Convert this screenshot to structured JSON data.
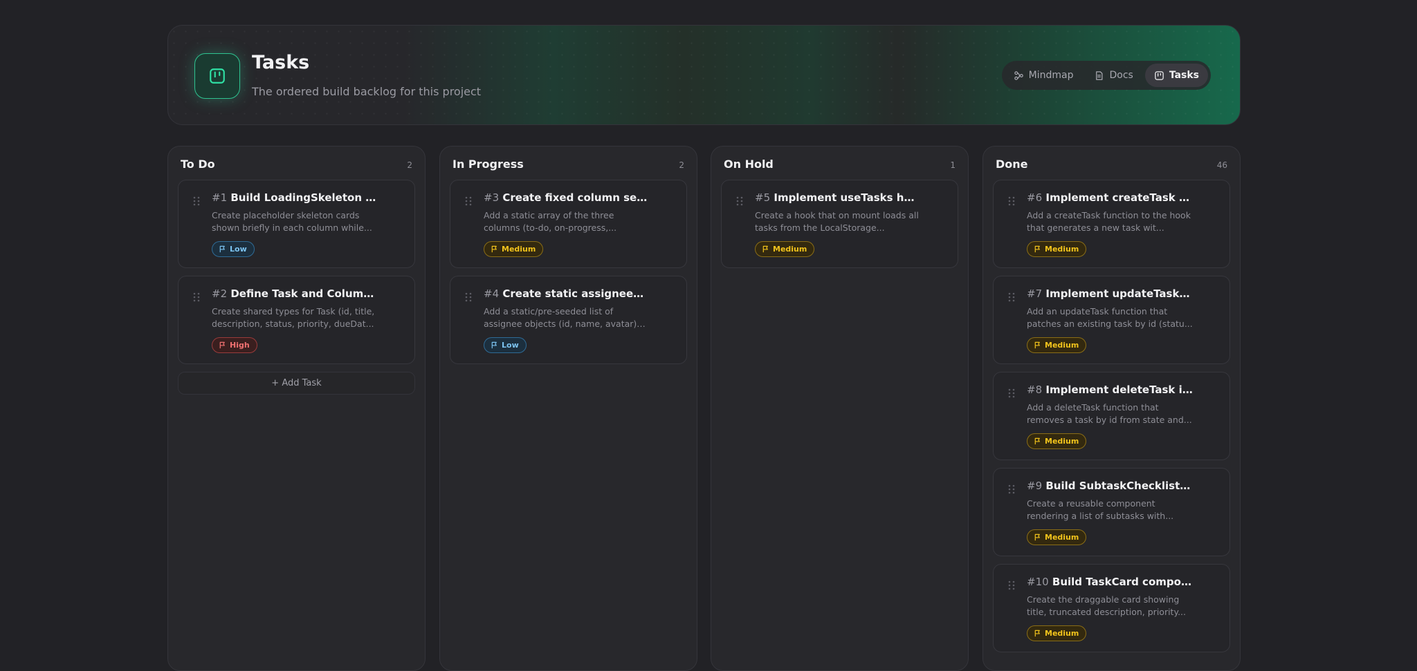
{
  "header": {
    "title": "Tasks",
    "subtitle": "The ordered build backlog for this project",
    "nav": [
      {
        "label": "Mindmap",
        "icon": "mindmap-icon",
        "active": false
      },
      {
        "label": "Docs",
        "icon": "docs-icon",
        "active": false
      },
      {
        "label": "Tasks",
        "icon": "tasks-icon",
        "active": true
      }
    ]
  },
  "colors": {
    "accent": "#2fc491",
    "low": "#7cc3f0",
    "medium": "#f2c31c",
    "high": "#f07171"
  },
  "columns": [
    {
      "title": "To Do",
      "count": "2",
      "cards": [
        {
          "num": "#1",
          "title": "Build LoadingSkeleton co...",
          "desc": "Create placeholder skeleton cards shown briefly in each column while...",
          "priority": "Low"
        },
        {
          "num": "#2",
          "title": "Define Task and Column T...",
          "desc": "Create shared types for Task (id, title, description, status, priority, dueDat...",
          "priority": "High"
        }
      ],
      "add_label": "+ Add Task"
    },
    {
      "title": "In Progress",
      "count": "2",
      "cards": [
        {
          "num": "#3",
          "title": "Create fixed column seed ...",
          "desc": "Add a static array of the three columns (to-do, on-progress,...",
          "priority": "Medium"
        },
        {
          "num": "#4",
          "title": "Create static assignees se...",
          "desc": "Add a static/pre-seeded list of assignee objects (id, name, avatar) f...",
          "priority": "Low"
        }
      ]
    },
    {
      "title": "On Hold",
      "count": "1",
      "cards": [
        {
          "num": "#5",
          "title": "Implement useTasks hook...",
          "desc": "Create a hook that on mount loads all tasks from the LocalStorage...",
          "priority": "Medium"
        }
      ]
    },
    {
      "title": "Done",
      "count": "46",
      "cards": [
        {
          "num": "#6",
          "title": "Implement createTask in ...",
          "desc": "Add a createTask function to the hook that generates a new task wit...",
          "priority": "Medium"
        },
        {
          "num": "#7",
          "title": "Implement updateTask in ...",
          "desc": "Add an updateTask function that patches an existing task by id (statu...",
          "priority": "Medium"
        },
        {
          "num": "#8",
          "title": "Implement deleteTask in ...",
          "desc": "Add a deleteTask function that removes a task by id from state and...",
          "priority": "Medium"
        },
        {
          "num": "#9",
          "title": "Build SubtaskChecklist co...",
          "desc": "Create a reusable component rendering a list of subtasks with...",
          "priority": "Medium"
        },
        {
          "num": "#10",
          "title": "Build TaskCard component",
          "desc": "Create the draggable card showing title, truncated description, priority...",
          "priority": "Medium"
        }
      ]
    }
  ]
}
